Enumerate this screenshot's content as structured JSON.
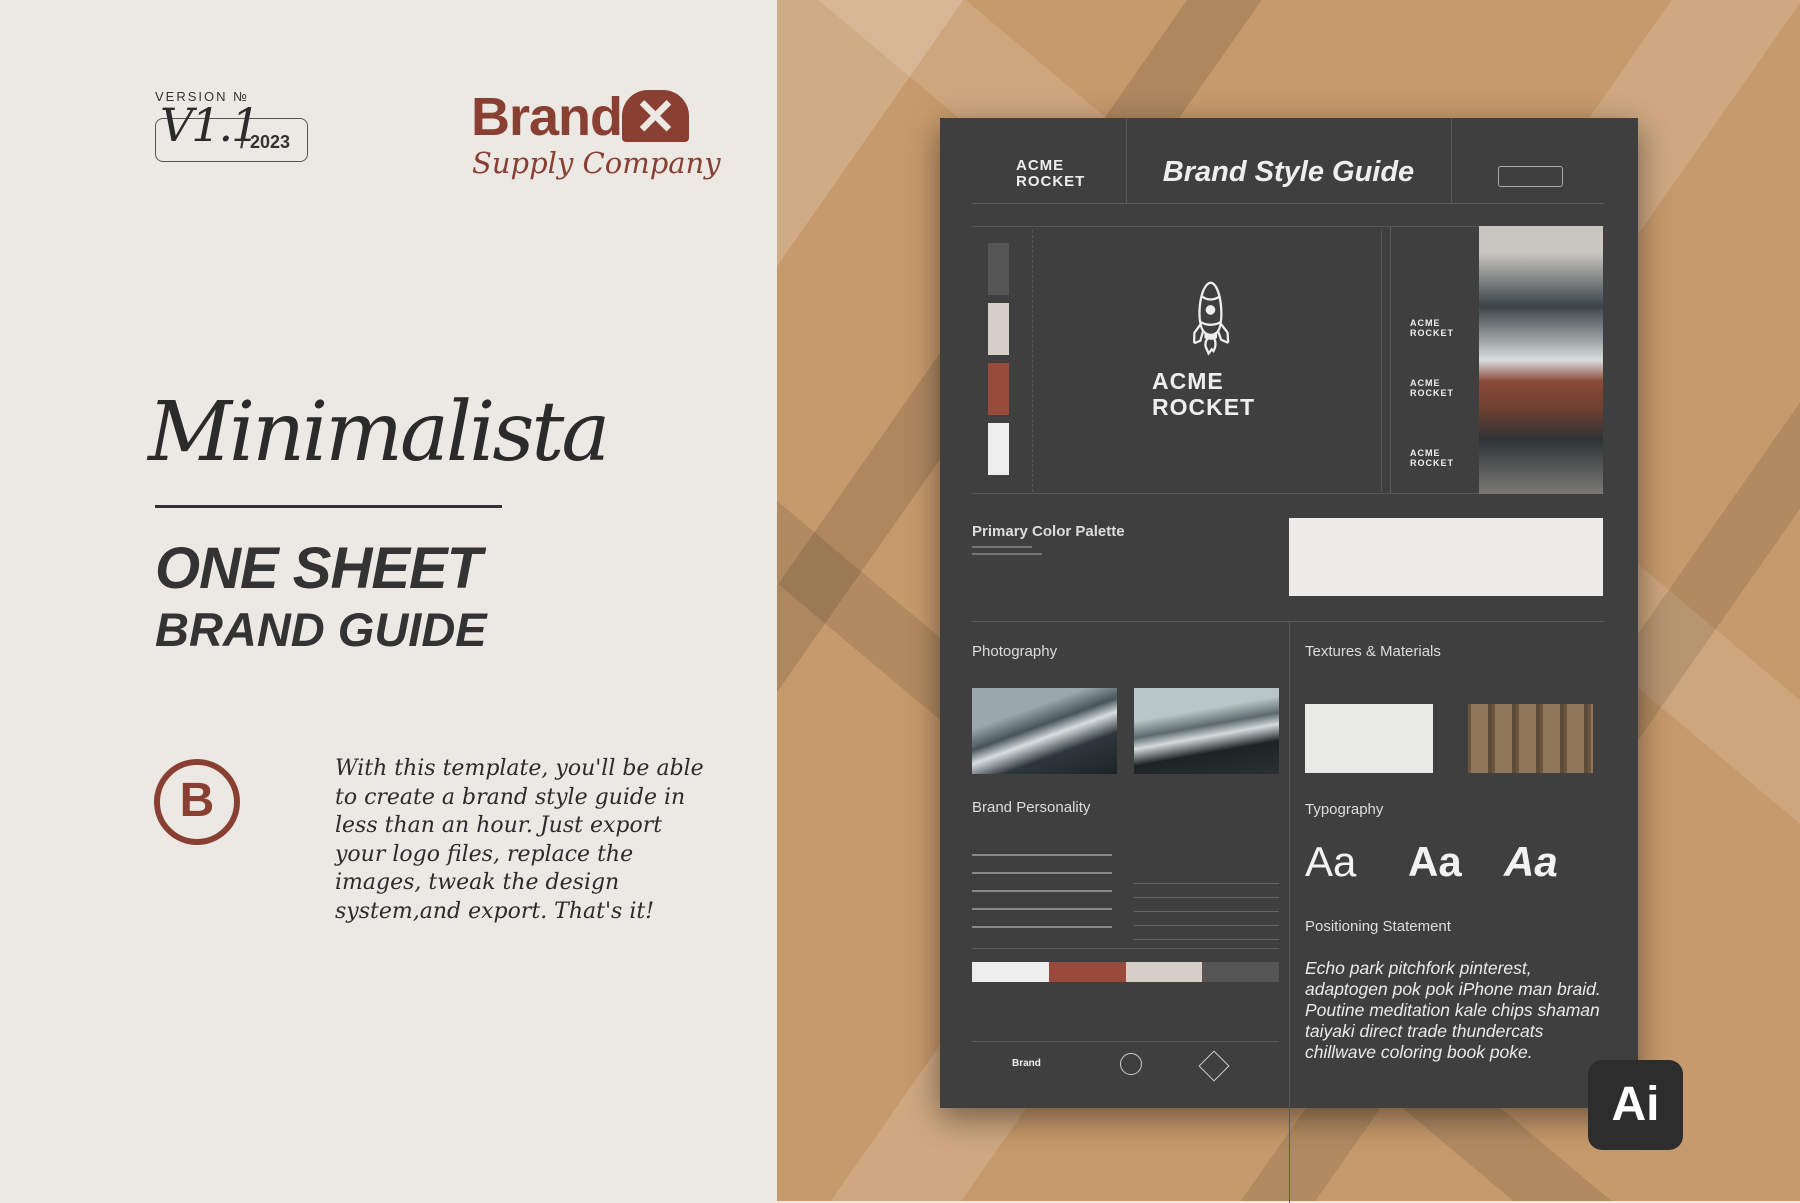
{
  "left": {
    "version_label": "VERSION №",
    "version_number": "V1.1",
    "version_year": "/ 2023",
    "brand_name": "Brand",
    "brand_mark": "✕",
    "brand_tagline": "Supply Company",
    "script_title": "Minimalista",
    "headline_1": "ONE SHEET",
    "headline_2": "BRAND GUIDE",
    "circle_logo": "B",
    "description": "With this template, you'll be able to create a brand style guide in less than an hour. Just export your logo files, replace the images, tweak the design system,and export. That's it!"
  },
  "sheet": {
    "logo_text": "ACME ROCKET",
    "title": "Brand Style Guide",
    "primary_palette": "Primary Color Palette",
    "photography": "Photography",
    "textures": "Textures & Materials",
    "brand_personality": "Brand Personality",
    "typography": "Typography",
    "typography_samples": [
      "Aa",
      "Aa",
      "Aa"
    ],
    "positioning": "Positioning Statement",
    "positioning_text": "Echo park pitchfork pinterest, adaptogen pok pok iPhone man braid. Poutine meditation kale chips shaman taiyaki direct trade thundercats chillwave coloring book poke.",
    "swatches": [
      "#555555",
      "#d6cfc8",
      "#9a4a3a",
      "#eeeeee"
    ],
    "secondary_colors": [
      "#eeeeee",
      "#9a4a3a",
      "#d6cfc8",
      "#555555"
    ]
  },
  "badge": "Ai",
  "colors": {
    "accent": "#8a3f33",
    "sheet": "#3f3f3f",
    "paper": "#c69a6c",
    "panel": "#ece8e4"
  }
}
